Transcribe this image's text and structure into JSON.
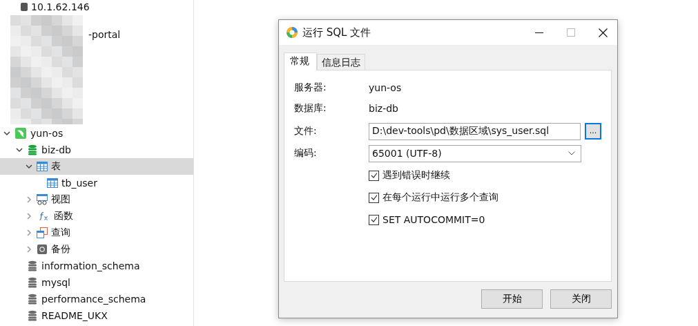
{
  "tree_top": {
    "host": "10.1.62.146",
    "partial_item": "-portal"
  },
  "tree": [
    {
      "name": "yun-os",
      "expanded": true,
      "children": [
        {
          "name": "biz-db",
          "opened": true,
          "children": [
            {
              "name": "表",
              "kind": "table",
              "expanded": true,
              "selected": true,
              "children": [
                {
                  "name": "tb_user"
                }
              ]
            },
            {
              "name": "视图",
              "kind": "view",
              "expanded": false,
              "selected": false
            },
            {
              "name": "函数",
              "kind": "function",
              "expanded": false,
              "selected": false
            },
            {
              "name": "查询",
              "kind": "query",
              "expanded": false,
              "selected": false
            },
            {
              "name": "备份",
              "kind": "backup",
              "expanded": false,
              "selected": false
            }
          ]
        },
        {
          "name": "information_schema",
          "opened": false
        },
        {
          "name": "mysql",
          "opened": false
        },
        {
          "name": "performance_schema",
          "opened": false
        },
        {
          "name": "README_UKX",
          "opened": false
        }
      ]
    }
  ],
  "dialog": {
    "title": "运行 SQL 文件",
    "tabs": [
      {
        "label": "常规",
        "selected": true
      },
      {
        "label": "信息日志",
        "selected": false
      }
    ],
    "server": {
      "label": "服务器:",
      "value": "yun-os"
    },
    "database": {
      "label": "数据库:",
      "value": "biz-db"
    },
    "file": {
      "label": "文件:",
      "value": "D:\\dev-tools\\pd\\数据区域\\sys_user.sql",
      "browse": "..."
    },
    "encoding": {
      "label": "编码:",
      "value": "65001 (UTF-8)"
    },
    "options": [
      {
        "label": "遇到错误时继续",
        "checked": true
      },
      {
        "label": "在每个运行中运行多个查询",
        "checked": true
      },
      {
        "label": "SET AUTOCOMMIT=0",
        "checked": true
      }
    ],
    "buttons": [
      "开始",
      "关闭"
    ]
  }
}
